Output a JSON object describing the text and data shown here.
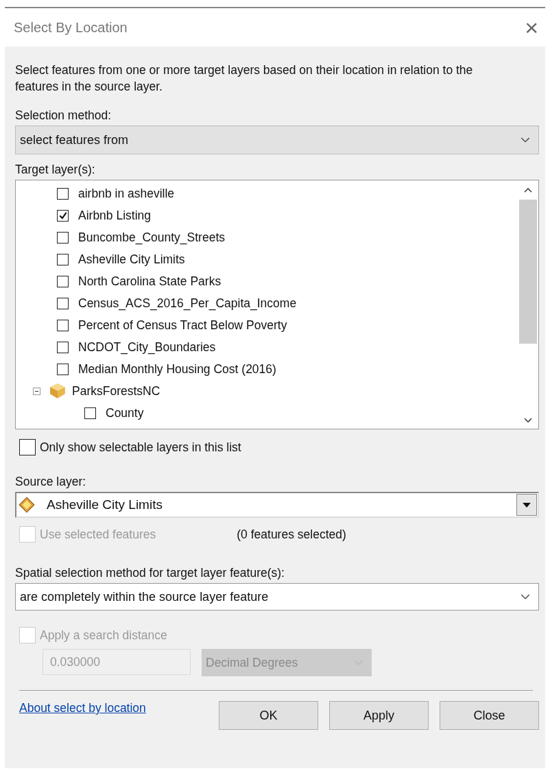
{
  "window": {
    "title": "Select By Location",
    "close": "×"
  },
  "description": "Select features from one or more target layers based on their location in relation to the features in the source layer.",
  "selection_method": {
    "label": "Selection method:",
    "value": "select features from"
  },
  "target_layers": {
    "label": "Target layer(s):",
    "items": [
      {
        "kind": "layer",
        "label": "airbnb in asheville",
        "checked": false
      },
      {
        "kind": "layer",
        "label": "Airbnb Listing",
        "checked": true
      },
      {
        "kind": "layer",
        "label": "Buncombe_County_Streets",
        "checked": false
      },
      {
        "kind": "layer",
        "label": "Asheville City Limits",
        "checked": false
      },
      {
        "kind": "layer",
        "label": "North Carolina State Parks",
        "checked": false
      },
      {
        "kind": "layer",
        "label": "Census_ACS_2016_Per_Capita_Income",
        "checked": false
      },
      {
        "kind": "layer",
        "label": "Percent of Census Tract Below Poverty",
        "checked": false
      },
      {
        "kind": "layer",
        "label": "NCDOT_City_Boundaries",
        "checked": false
      },
      {
        "kind": "layer",
        "label": "Median Monthly Housing Cost (2016)",
        "checked": false
      },
      {
        "kind": "group",
        "label": "ParksForestsNC",
        "expanded": true,
        "children": [
          {
            "kind": "layer",
            "label": "County",
            "checked": false
          }
        ]
      }
    ]
  },
  "only_selectable": {
    "label": "Only show selectable layers in this list",
    "checked": false
  },
  "source_layer": {
    "label": "Source layer:",
    "value": "Asheville City Limits"
  },
  "use_selected": {
    "label": "Use selected features",
    "checked": false,
    "disabled": true,
    "count": "(0 features selected)"
  },
  "spatial_method": {
    "label": "Spatial selection method for target layer feature(s):",
    "value": "are completely within the source layer feature"
  },
  "search_distance": {
    "label": "Apply a search distance",
    "checked": false,
    "disabled": true,
    "value": "0.030000",
    "units": "Decimal Degrees"
  },
  "help_link": "About select by location",
  "buttons": [
    "OK",
    "Apply",
    "Close"
  ]
}
